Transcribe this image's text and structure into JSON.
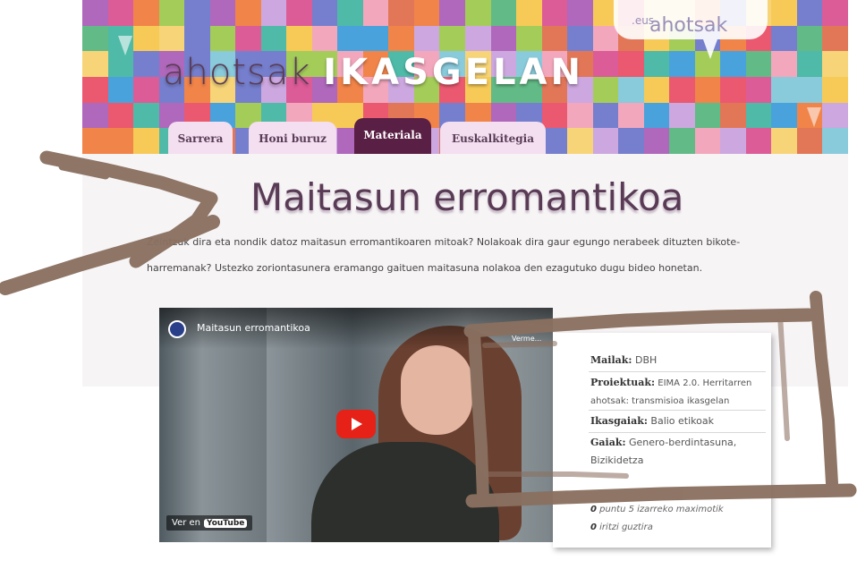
{
  "site": {
    "brand_light": "ahotsak",
    "brand_bold": "IKASGELAN",
    "logo_text": "ahotsak",
    "logo_suffix": ".eus"
  },
  "tabs": [
    {
      "label": "Sarrera",
      "active": false
    },
    {
      "label": "Honi buruz",
      "active": false
    },
    {
      "label": "Materiala",
      "active": true
    },
    {
      "label": "Euskalkitegia",
      "active": false
    }
  ],
  "main": {
    "title": "Maitasun erromantikoa",
    "intro": "Zeintzuk dira eta nondik datoz maitasun erromantikoaren mitoak? Nolakoak dira gaur egungo nerabeek dituzten bikote-harremanak? Ustezko zoriontasunera eramango gaituen maitasuna nolakoa den ezagutuko dugu bideo honetan."
  },
  "video": {
    "title": "Maitasun erromantikoa",
    "watch_label": "Ver en",
    "watch_brand": "YouTube",
    "top_right": "Verme..."
  },
  "info": {
    "mailak_label": "Mailak:",
    "mailak_value": "DBH",
    "proiektuak_label": "Proiektuak:",
    "proiektuak_value": "EIMA 2.0. Herritarren ahotsak: transmisioa ikasgelan",
    "ikasgaiak_label": "Ikasgaiak:",
    "ikasgaiak_value": "Balio etikoak",
    "gaiak_label": "Gaiak:",
    "gaiak_value": "Genero-berdintasuna, Bizikidetza",
    "points_count": "0",
    "points_text": "puntu 5 izarreko maximotik",
    "votes_count": "0",
    "votes_text": "iritzi guztira"
  },
  "colors": {
    "accent": "#5a1f44",
    "tab_bg": "#f3dff0",
    "title_color": "#5a3b56",
    "marker_brown": "#8a7060"
  }
}
